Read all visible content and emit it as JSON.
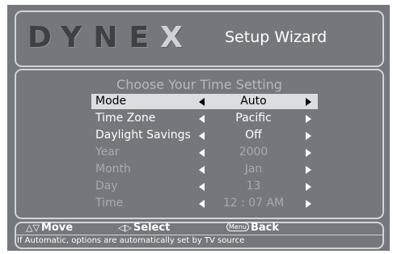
{
  "header": {
    "logo": "DYNEX",
    "title": "Setup Wizard"
  },
  "main": {
    "section_title": "Choose Your Time Setting",
    "rows": [
      {
        "label": "Mode",
        "value": "Auto"
      },
      {
        "label": "Time Zone",
        "value": "Pacific"
      },
      {
        "label": "Daylight Savings",
        "value": "Off"
      },
      {
        "label": "Year",
        "value": "2000"
      },
      {
        "label": "Month",
        "value": "Jan"
      },
      {
        "label": "Day",
        "value": "13"
      },
      {
        "label": "Time",
        "value": "12 : 07 AM"
      }
    ]
  },
  "footer": {
    "move_label": "Move",
    "select_label": "Select",
    "menu_key": "Menu",
    "back_label": "Back",
    "help_text": "If Automatic, options are automatically set by TV source"
  },
  "colors": {
    "background": "#74777c",
    "border": "#d2d4d8",
    "highlight": "#dcdde0",
    "disabled_text": "#a9abaf"
  },
  "icons": {
    "move": "up-down-arrows-icon",
    "select": "left-right-arrows-icon",
    "back": "menu-button-icon"
  }
}
